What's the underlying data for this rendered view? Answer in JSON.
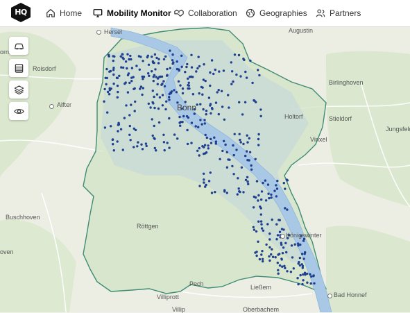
{
  "brand": {
    "logo_text": "HQ"
  },
  "nav": {
    "home": "Home",
    "mobility_monitor": "Mobility Monitor",
    "collaboration": "Collaboration",
    "geographies": "Geographies",
    "partners": "Partners"
  },
  "map": {
    "tools": [
      "car-icon",
      "layers-stack-icon",
      "layers-icon",
      "eye-icon"
    ],
    "colors": {
      "water": "#a9c8e6",
      "park": "#cfe3c3",
      "boundary": "#3f8b73",
      "vehicle_dot": "#1f3f8f"
    },
    "places": {
      "hersel": "Hersel",
      "augustin": "Augustin",
      "bornheim": "ornheim",
      "roisdorf": "Roisdorf",
      "birlinghoven": "Birlinghoven",
      "alfter": "Alfter",
      "bonn": "Bonn",
      "holtorf": "Holtorf",
      "stieldorf": "Stieldorf",
      "jungsfeld": "Jungsfeld",
      "vinxel": "Vinxel",
      "buschhoven": "Buschhoven",
      "roettgen": "Röttgen",
      "koenigswinter": "Königswinter",
      "oven": "oven",
      "pech": "Pech",
      "liessem": "Ließem",
      "villiprott": "Villiprott",
      "bad_honnef": "Bad Honnef",
      "villip": "Villip",
      "oberbachem": "Oberbachem"
    }
  }
}
